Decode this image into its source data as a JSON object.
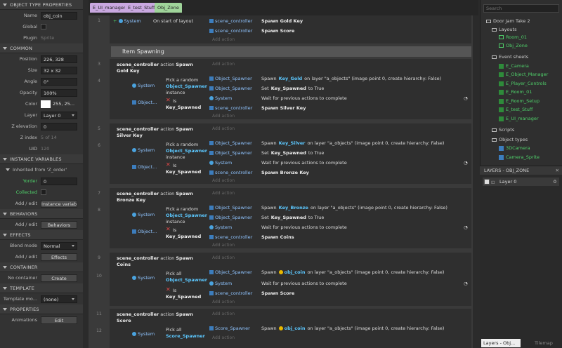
{
  "left_panel": {
    "object_type_properties": {
      "header": "OBJECT TYPE PROPERTIES",
      "name_label": "Name",
      "name_value": "obj_coin",
      "global_label": "Global",
      "plugin_label": "Plugin",
      "plugin_value": "Sprite"
    },
    "common": {
      "header": "COMMON",
      "position_label": "Position",
      "position_value": "226, 328",
      "size_label": "Size",
      "size_value": "32 x 32",
      "angle_label": "Angle",
      "angle_value": "0°",
      "opacity_label": "Opacity",
      "opacity_value": "100%",
      "color_label": "Color",
      "color_value": "255, 25...",
      "layer_label": "Layer",
      "layer_value": "Layer 0",
      "zelev_label": "Z elevation",
      "zelev_value": "0",
      "zindex_label": "Z index",
      "zindex_value": "5 of 14",
      "uid_label": "UID",
      "uid_value": "120"
    },
    "instance_variables": {
      "header": "INSTANCE VARIABLES",
      "inherited": "Inherited from 'Z_order'",
      "yorder_label": "Yorder",
      "yorder_value": "0",
      "collected_label": "Collected",
      "addedit_label": "Add / edit",
      "addedit_button": "Instance variables"
    },
    "behaviors": {
      "header": "BEHAVIORS",
      "addedit_label": "Add / edit",
      "button": "Behaviors"
    },
    "effects": {
      "header": "EFFECTS",
      "blend_label": "Blend mode",
      "blend_value": "Normal",
      "addedit_label": "Add / edit",
      "button": "Effects"
    },
    "container": {
      "header": "CONTAINER",
      "label": "No container",
      "button": "Create"
    },
    "template": {
      "header": "TEMPLATE",
      "label": "Template mo...",
      "value": "(none)"
    },
    "properties": {
      "header": "PROPERTIES",
      "anim_label": "Animations",
      "anim_button": "Edit"
    }
  },
  "tabs": [
    "E_UI_manager",
    "E_test_Stuff",
    "Obj_Zone"
  ],
  "sheet": {
    "add_action": "Add action",
    "system": "System",
    "row1": {
      "num": "1",
      "cond": "On start of layout",
      "a1_obj": "scene_controller",
      "a1_text": "Spawn Gold Key",
      "a2_obj": "scene_controller",
      "a2_text": "Spawn Score"
    },
    "group_title": "Item Spawning",
    "ev_nums": [
      "3",
      "4",
      "5",
      "6",
      "7",
      "8",
      "9",
      "10",
      "11",
      "12"
    ],
    "events": [
      {
        "head_obj": "scene_controller",
        "head_rest": " action ",
        "head_bold": "Spawn Gold Key",
        "pick": "Pick a random",
        "pick_obj": "Object_Spawner",
        "pick_inst": "instance",
        "obj_short": "Object...",
        "is": "Is",
        "is_key": "Key_Spawned",
        "a1_obj": "Object_Spawner",
        "a1_pre": "Spawn",
        "a1_key": "Key_Gold",
        "a1_post": "on layer \"a_objects\" (image point 0, create hierarchy: False)",
        "a2_obj": "Object_Spawner",
        "a2_pre": "Set",
        "a2_key": "Key_Spawned",
        "a2_post": "to True",
        "a3_obj": "System",
        "a3_text": "Wait for previous actions to complete",
        "a4_obj": "scene_controller",
        "a4_text": "Spawn Silver Key"
      },
      {
        "head_obj": "scene_controller",
        "head_rest": " action ",
        "head_bold": "Spawn Silver Key",
        "pick": "Pick a random",
        "pick_obj": "Object_Spawner",
        "pick_inst": "instance",
        "obj_short": "Object...",
        "is": "Is",
        "is_key": "Key_Spawned",
        "a1_obj": "Object_Spawner",
        "a1_pre": "Spawn",
        "a1_key": "Key_Silver",
        "a1_post": "on layer \"a_objects\" (image point 0, create hierarchy: False)",
        "a2_obj": "Object_Spawner",
        "a2_pre": "Set",
        "a2_key": "Key_Spawned",
        "a2_post": "to True",
        "a3_obj": "System",
        "a3_text": "Wait for previous actions to complete",
        "a4_obj": "scene_controller",
        "a4_text": "Spawn Bronze Key"
      },
      {
        "head_obj": "scene_controller",
        "head_rest": " action ",
        "head_bold": "Spawn Bronze Key",
        "pick": "Pick a random",
        "pick_obj": "Object_Spawner",
        "pick_inst": "instance",
        "obj_short": "Object...",
        "is": "Is",
        "is_key": "Key_Spawned",
        "a1_obj": "Object_Spawner",
        "a1_pre": "Spawn",
        "a1_key": "Key_Bronze",
        "a1_post": "on layer \"a_objects\" (image point 0, create hierarchy: False)",
        "a2_obj": "Object_Spawner",
        "a2_pre": "Set",
        "a2_key": "Key_Spawned",
        "a2_post": "to True",
        "a3_obj": "System",
        "a3_text": "Wait for previous actions to complete",
        "a4_obj": "scene_controller",
        "a4_text": "Spawn Coins"
      }
    ],
    "coins_event": {
      "head_obj": "scene_controller",
      "head_rest": " action ",
      "head_bold": "Spawn Coins",
      "pick": "Pick all",
      "pick_obj": "Object_Spawner",
      "is": "Is",
      "is_key": "Key_Spawned",
      "a1_obj": "Object_Spawner",
      "a1_pre": "Spawn",
      "a1_key": "obj_coin",
      "a1_post": "on layer \"a_objects\" (image point 0, create hierarchy: False)",
      "a2_obj": "System",
      "a2_text": "Wait for previous actions to complete",
      "a3_obj": "scene_controller",
      "a3_text": "Spawn Score"
    },
    "score_event": {
      "head_obj": "scene_controller",
      "head_rest": " action ",
      "head_bold": "Spawn Score",
      "pick": "Pick all",
      "pick_obj": "Score_Spawner",
      "a1_obj": "Score_Spawner",
      "a1_pre": "Spawn",
      "a1_key": "obj_coin",
      "a1_post": "on layer \"a_objects\" (image point 0, create hierarchy: False)"
    }
  },
  "project": {
    "search_placeholder": "Search",
    "root": "Door Jam Take 2",
    "layouts": "Layouts",
    "layout_items": [
      "Room_01",
      "Obj_Zone"
    ],
    "event_sheets": "Event sheets",
    "sheet_items": [
      "E_Camera",
      "E_Object_Manager",
      "E_Player_Controls",
      "E_Room_01",
      "E_Room_Setup",
      "E_test_Stuff",
      "E_UI_manager"
    ],
    "scripts": "Scripts",
    "object_types": "Object types",
    "object_items": [
      "3DCamera",
      "Camera_Sprite"
    ]
  },
  "layers": {
    "header": "LAYERS - OBJ_ZONE",
    "layer_name": "Layer 0",
    "layer_count": "0",
    "bottom_tab": "Layers - Obj...",
    "bottom_tab2": "Tilemap"
  },
  "colors": {
    "accent": "#5cc8ff",
    "group": "#555555",
    "green": "#4fd06a"
  }
}
